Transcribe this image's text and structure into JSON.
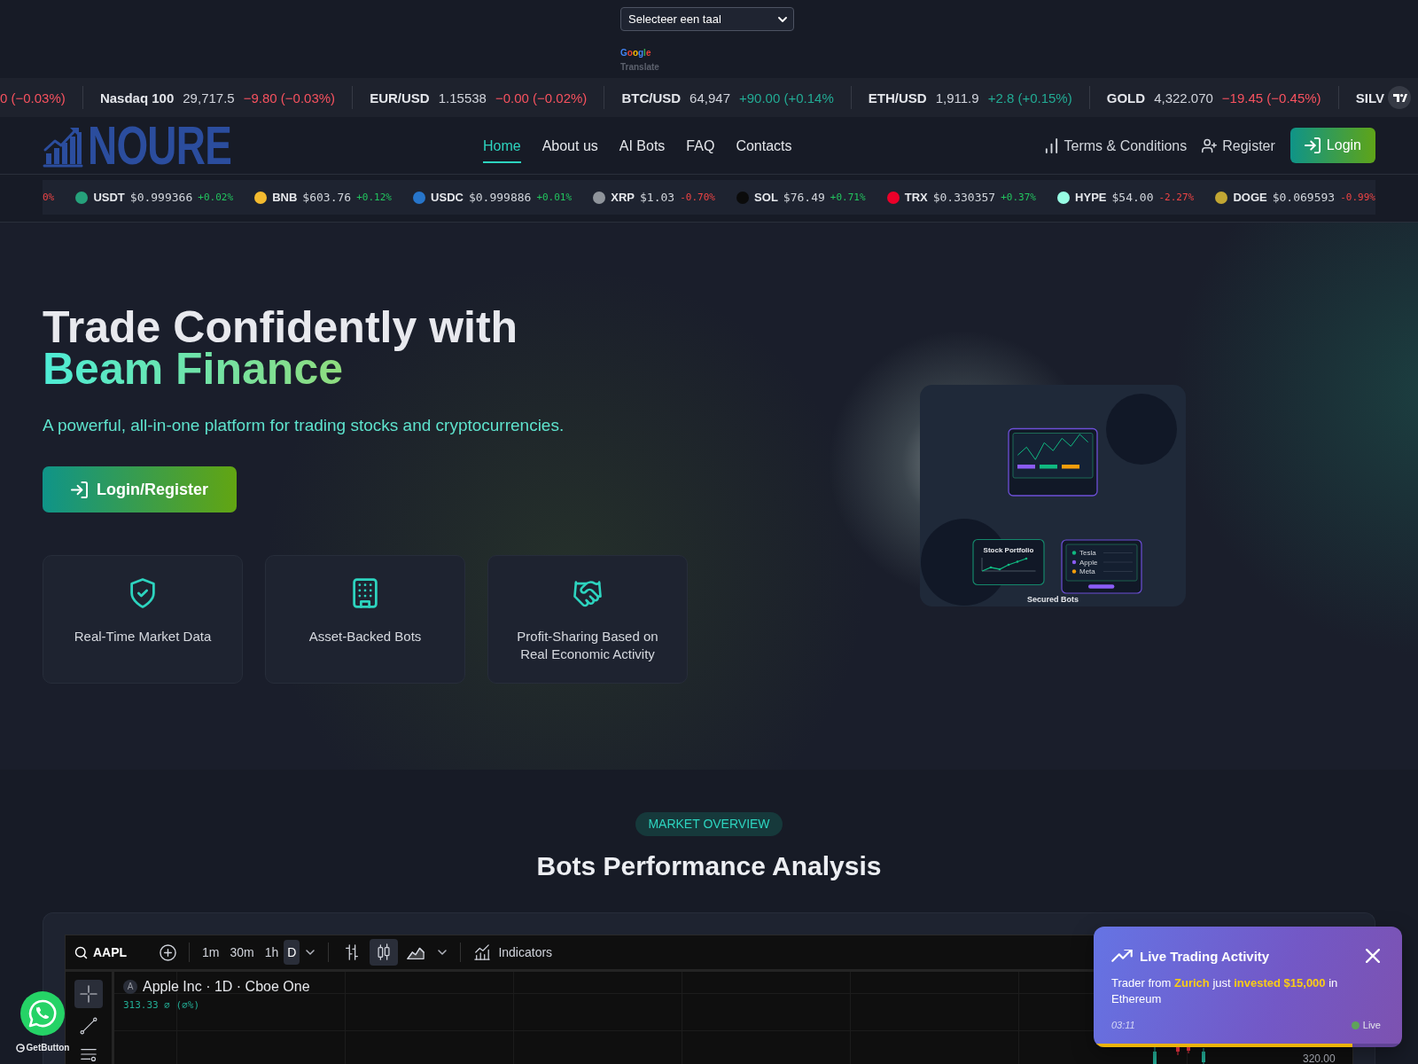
{
  "language_select": {
    "value": "Selecteer een taal",
    "brand": "Google",
    "caption": "Translate"
  },
  "market_ticker": {
    "items": [
      {
        "change": "0 (−0.03%)",
        "positive": false
      },
      {
        "symbol": "Nasdaq 100",
        "price": "29,717.5",
        "change": "−9.80 (−0.03%)",
        "positive": false
      },
      {
        "symbol": "EUR/USD",
        "price": "1.15538",
        "change": "−0.00 (−0.02%)",
        "positive": false
      },
      {
        "symbol": "BTC/USD",
        "price": "64,947",
        "change": "+90.00 (+0.14%",
        "positive": true
      },
      {
        "symbol": "ETH/USD",
        "price": "1,911.9",
        "change": "+2.8 (+0.15%)",
        "positive": true
      },
      {
        "symbol": "GOLD",
        "price": "4,322.070",
        "change": "−19.45 (−0.45%)",
        "positive": false
      },
      {
        "symbol": "SILV"
      }
    ]
  },
  "navbar": {
    "logo": "NOURE",
    "links": [
      {
        "label": "Home",
        "selected": true
      },
      {
        "label": "About us",
        "selected": false
      },
      {
        "label": "AI Bots",
        "selected": false
      },
      {
        "label": "FAQ",
        "selected": false
      },
      {
        "label": "Contacts",
        "selected": false
      }
    ],
    "actions": [
      {
        "label": "Terms & Conditions",
        "kind": "link"
      },
      {
        "label": "Register",
        "kind": "link"
      },
      {
        "label": "Login",
        "kind": "button"
      }
    ]
  },
  "crypto_ticker": {
    "items": [
      {
        "change": "0%",
        "positive": false
      },
      {
        "symbol": "USDT",
        "price": "$0.999366",
        "change": "+0.02%",
        "positive": true,
        "color": "#26a17b"
      },
      {
        "symbol": "BNB",
        "price": "$603.76",
        "change": "+0.12%",
        "positive": true,
        "color": "#f3ba2f"
      },
      {
        "symbol": "USDC",
        "price": "$0.999886",
        "change": "+0.01%",
        "positive": true,
        "color": "#2775ca"
      },
      {
        "symbol": "XRP",
        "price": "$1.03",
        "change": "-0.70%",
        "positive": false,
        "color": "#8f949b"
      },
      {
        "symbol": "SOL",
        "price": "$76.49",
        "change": "+0.71%",
        "positive": true,
        "color": "#0b0b0b"
      },
      {
        "symbol": "TRX",
        "price": "$0.330357",
        "change": "+0.37%",
        "positive": true,
        "color": "#eb0029"
      },
      {
        "symbol": "HYPE",
        "price": "$54.00",
        "change": "-2.27%",
        "positive": false,
        "color": "#97fce4"
      },
      {
        "symbol": "DOGE",
        "price": "$0.069593",
        "change": "-0.99%",
        "positive": false,
        "color": "#c2a633"
      }
    ]
  },
  "hero": {
    "title": "Trade Confidently with",
    "highlight": "Beam Finance",
    "subtitle": "A powerful, all-in-one platform for trading stocks and cryptocurrencies.",
    "cta": "Login/Register",
    "features": [
      {
        "label": "Real-Time Market Data"
      },
      {
        "label": "Asset-Backed Bots"
      },
      {
        "label": "Profit-Sharing Based on Real Economic Activity"
      }
    ],
    "illustration": {
      "portfolio_title": "Stock Portfolio",
      "legend": [
        {
          "label": "Tesla",
          "color": "#10b981"
        },
        {
          "label": "Apple",
          "color": "#8b5cf6"
        },
        {
          "label": "Meta",
          "color": "#f59e0b"
        }
      ],
      "caption": "Secured Bots"
    }
  },
  "market_overview": {
    "badge": "MARKET OVERVIEW",
    "title": "Bots Performance Analysis",
    "chart_widget": {
      "symbol": "AAPL",
      "intervals": [
        {
          "label": "1m",
          "selected": false
        },
        {
          "label": "30m",
          "selected": false
        },
        {
          "label": "1h",
          "selected": false
        },
        {
          "label": "D",
          "selected": true
        }
      ],
      "chart_styles": [
        {
          "selected": false
        },
        {
          "selected": true
        },
        {
          "selected": false
        }
      ],
      "indicators": "Indicators",
      "tools": [
        {
          "selected": true
        },
        {
          "selected": false
        },
        {
          "selected": false
        }
      ],
      "badge": "A",
      "title": "Apple Inc · 1D · Cboe One",
      "legend": "313.33 ∅ (∅%)",
      "price_label": "320.00"
    }
  },
  "toast": {
    "title": "Live Trading Activity",
    "message": "Trader from **Zurich** just **invested $15,000** in Ethereum",
    "time": "03:11",
    "status": "Live",
    "level": 0.84
  },
  "whatsapp": {
    "label": "GetButton"
  }
}
